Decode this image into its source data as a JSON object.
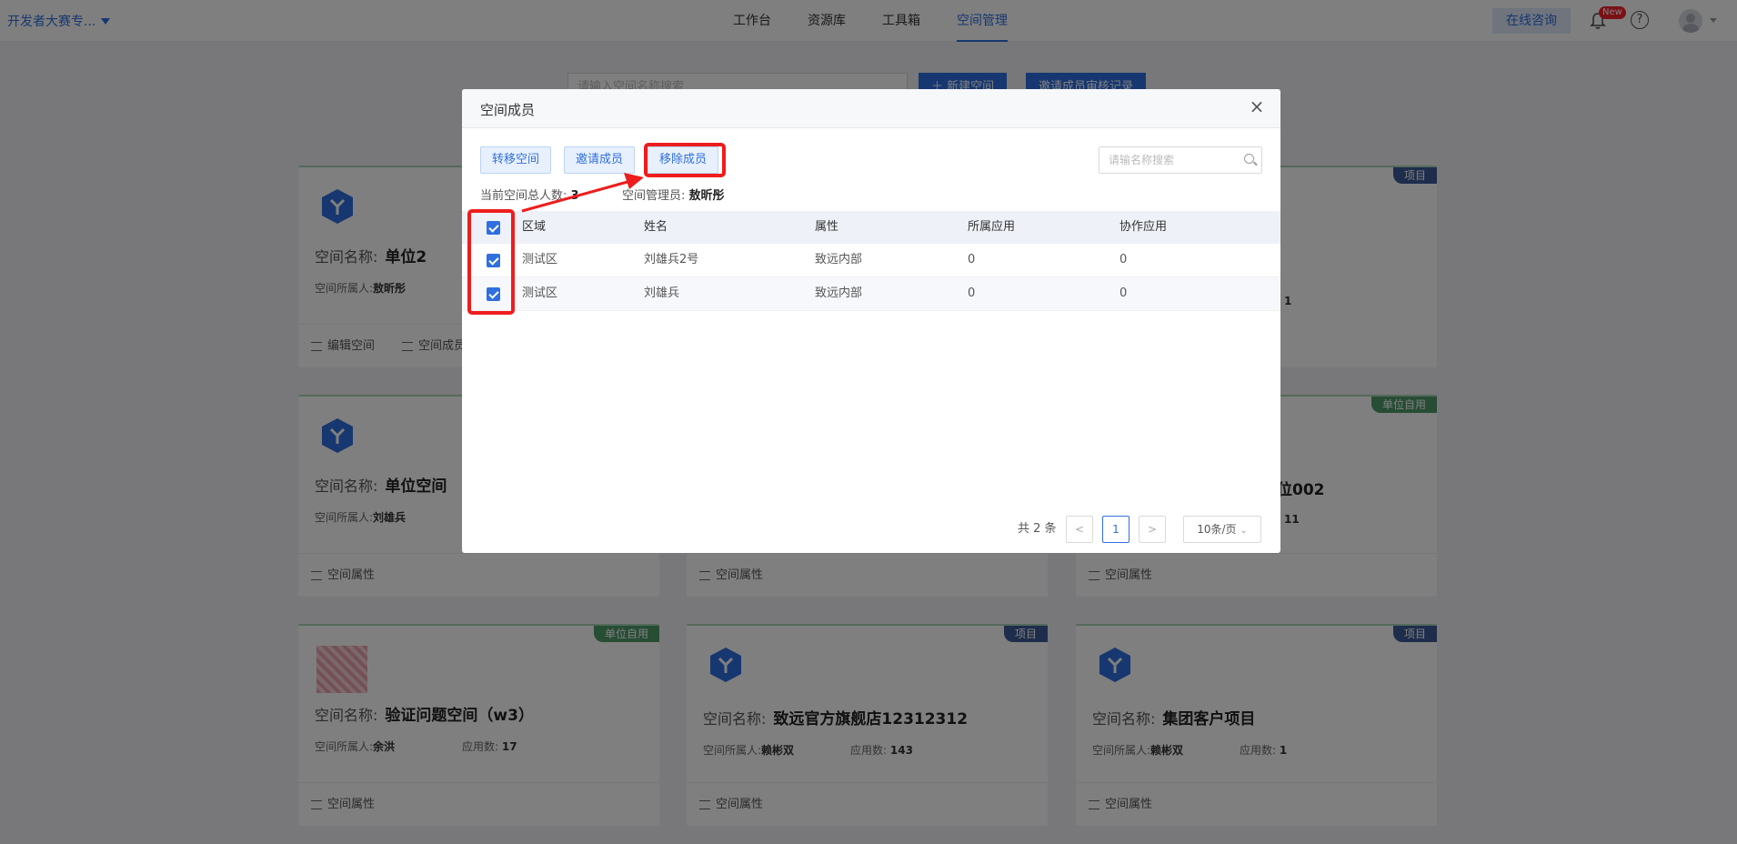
{
  "topnav": {
    "org": "开发者大赛专...",
    "links": [
      "工作台",
      "资源库",
      "工具箱",
      "空间管理"
    ],
    "active_index": 3,
    "consult": "在线咨询",
    "new_badge": "New",
    "help_glyph": "?"
  },
  "page": {
    "search_placeholder": "请输入空间名称搜索",
    "new_space_button": "新建空间",
    "invite_record_button": "邀请成员审核记录"
  },
  "cards": [
    {
      "name_label": "空间名称:",
      "name": "单位2",
      "owner_label": "空间所属人:",
      "owner": "敖昕彤",
      "app_label": "",
      "apps": "",
      "tag": "",
      "footer": [
        "编辑空间",
        "空间成员"
      ]
    },
    {
      "name_label": "",
      "name": "",
      "owner_label": "",
      "owner": "",
      "app_label": "",
      "apps": "1",
      "tag": "项目",
      "footer": []
    },
    {
      "name_label": "空间名称:",
      "name": "单位空间",
      "owner_label": "空间所属人:",
      "owner": "刘雄兵",
      "app_label": "",
      "apps": "",
      "tag": "",
      "footer": [
        "空间属性"
      ]
    },
    {
      "name_label": "",
      "name": "",
      "owner_label": "",
      "owner": "",
      "app_label": "",
      "apps": "",
      "tag": "",
      "footer": [
        "空间属性"
      ]
    },
    {
      "name_label": "",
      "name": "位002",
      "owner_label": "",
      "owner": "",
      "app_label": "",
      "apps": "11",
      "tag": "单位自用",
      "footer": [
        "空间属性"
      ]
    },
    {
      "name_label": "空间名称:",
      "name": "验证问题空间（w3）",
      "owner_label": "空间所属人:",
      "owner": "余洪",
      "app_label": "应用数:",
      "apps": "17",
      "tag": "单位自用",
      "footer": [
        "空间属性"
      ]
    },
    {
      "name_label": "空间名称:",
      "name": "致远官方旗舰店12312312",
      "owner_label": "空间所属人:",
      "owner": "赖彬双",
      "app_label": "应用数:",
      "apps": "143",
      "tag": "项目",
      "footer": [
        "空间属性"
      ]
    },
    {
      "name_label": "空间名称:",
      "name": "集团客户项目",
      "owner_label": "空间所属人:",
      "owner": "赖彬双",
      "app_label": "应用数:",
      "apps": "1",
      "tag": "项目",
      "footer": [
        "空间属性"
      ]
    }
  ],
  "modal": {
    "title": "空间成员",
    "close_glyph": "×",
    "buttons": {
      "transfer": "转移空间",
      "invite": "邀请成员",
      "remove": "移除成员"
    },
    "search_placeholder": "请输名称搜索",
    "total_label": "当前空间总人数:",
    "total_value": "3",
    "admin_label": "空间管理员:",
    "admin_value": "敖昕彤",
    "columns": [
      "区域",
      "姓名",
      "属性",
      "所属应用",
      "协作应用"
    ],
    "rows": [
      {
        "area": "测试区",
        "name": "刘雄兵2号",
        "attr": "致远内部",
        "apps": "0",
        "collab": "0",
        "checked": true
      },
      {
        "area": "测试区",
        "name": "刘雄兵",
        "attr": "致远内部",
        "apps": "0",
        "collab": "0",
        "checked": true
      }
    ],
    "select_all_checked": true,
    "pagination": {
      "total_text": "共 2 条",
      "prev": "<",
      "current": "1",
      "next": ">",
      "page_size": "10条/页"
    }
  },
  "colors": {
    "accent": "#2f6fe0",
    "annotation": "#ee1d1d",
    "tag_project": "#3d5a99",
    "tag_self": "#4f9a6a"
  }
}
